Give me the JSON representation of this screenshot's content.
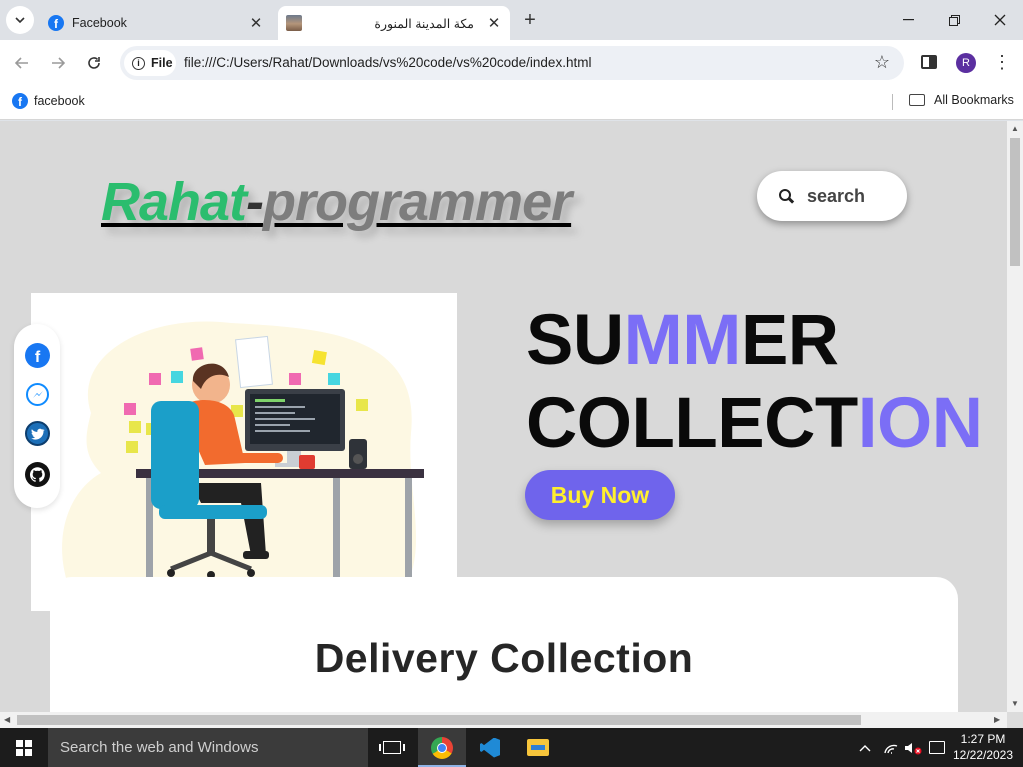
{
  "browser": {
    "tabs": [
      {
        "title": "Facebook",
        "icon": "facebook-icon"
      },
      {
        "title": "مكة المدينة المنورة",
        "icon": "image-thumbnail-icon"
      }
    ],
    "address_chip": "File",
    "url": "file:///C:/Users/Rahat/Downloads/vs%20code/vs%20code/index.html",
    "profile_initial": "R",
    "bookmarks": [
      {
        "label": "facebook",
        "icon": "facebook-icon"
      }
    ],
    "all_bookmarks": "All Bookmarks"
  },
  "page": {
    "logo": {
      "part1": "Rahat",
      "dash": "-",
      "part2": "programmer"
    },
    "search_label": "search",
    "headline": {
      "line1_a": "SU",
      "line1_b": "MM",
      "line1_c": "ER",
      "line2_a": "COLLECT",
      "line2_b": "ION"
    },
    "buy_button": "Buy Now",
    "delivery_title": "Delivery Collection",
    "social_icons": [
      "facebook-icon",
      "messenger-icon",
      "twitter-icon",
      "github-icon"
    ]
  },
  "taskbar": {
    "search_placeholder": "Search the web and Windows",
    "time": "1:27 PM",
    "date": "12/22/2023"
  },
  "colors": {
    "accent": "#7b6ef6",
    "logo_green": "#2bbd6e",
    "button_bg": "#6f64ec",
    "button_text": "#ffef2e"
  }
}
